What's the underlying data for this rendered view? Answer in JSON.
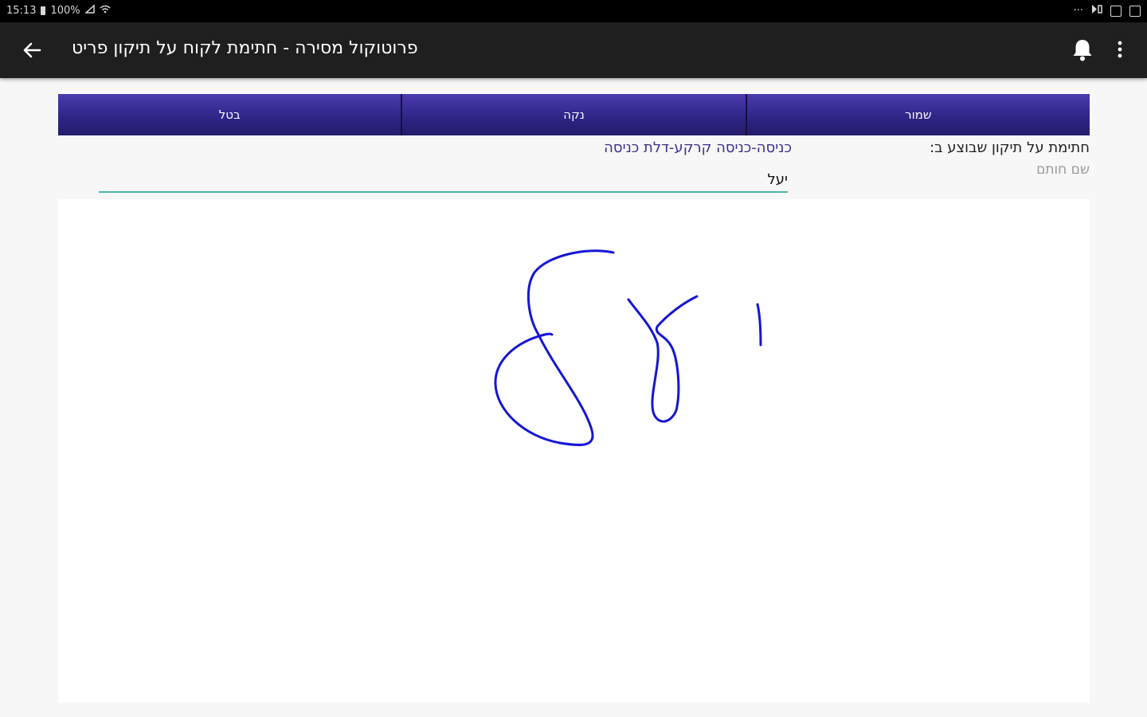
{
  "status_bar": {
    "time": "15:13",
    "battery": "100%",
    "more": "···"
  },
  "app_bar": {
    "title": "פרוטוקול מסירה - חתימת לקוח על תיקון פריט",
    "icons": [
      "arrow-back-icon",
      "bell-icon",
      "more-vert-icon"
    ]
  },
  "buttons": {
    "cancel": "בטל",
    "clear": "נקה",
    "save": "שמור"
  },
  "form": {
    "signature_label": "חתימת על תיקון שבוצע ב:",
    "location": "כניסה-כניסה קרקע-דלת כניסה",
    "signer_caption": "שם חותם",
    "signer_name": "יעל"
  },
  "colors": {
    "accent": "#2f2587",
    "ink": "#1515d6",
    "underline": "#4fb3a9",
    "app_bar": "#1f1f1f"
  }
}
